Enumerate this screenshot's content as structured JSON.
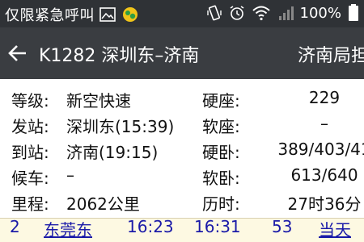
{
  "status_bar": {
    "notification_text": "仅限紧急呼叫",
    "battery_percent": "100%"
  },
  "toolbar": {
    "title": "K1282 深圳东–济南",
    "bureau": "济南局担"
  },
  "info": {
    "rows": [
      {
        "k1": "等级:",
        "v1": "新空快速",
        "k2": "硬座:",
        "v2": "229"
      },
      {
        "k1": "发站:",
        "v1": "深圳东(15:39)",
        "k2": "软座:",
        "v2": "–"
      },
      {
        "k1": "到站:",
        "v1": "济南(19:15)",
        "k2": "硬卧:",
        "v2": "389/403/41"
      },
      {
        "k1": "候车:",
        "v1": "–",
        "k2": "软卧:",
        "v2": "613/640"
      },
      {
        "k1": "里程:",
        "v1": "2062公里",
        "k2": "历时:",
        "v2": "27时36分"
      }
    ]
  },
  "stop_row": {
    "index": "2",
    "station": "东莞东",
    "arrive": "16:23",
    "depart": "16:31",
    "stay": "53",
    "day": "当天"
  },
  "colors": {
    "status_bar_bg": "#2f3236",
    "toolbar_bg": "#3a3d41",
    "link_blue": "#1a1aa8",
    "stop_row_bg": "#fdf9e2"
  }
}
